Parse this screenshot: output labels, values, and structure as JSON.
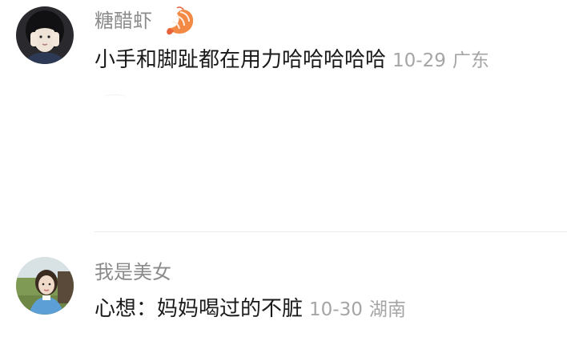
{
  "comments": [
    {
      "username": "糖醋虾",
      "badge_icon": "shrimp-emoji-icon",
      "text": "小手和脚趾都在用力哈哈哈哈哈",
      "date": "10-29",
      "location": "广东"
    },
    {
      "username": "我是美女",
      "text": "心想：妈妈喝过的不脏",
      "date": "10-30",
      "location": "湖南"
    }
  ]
}
